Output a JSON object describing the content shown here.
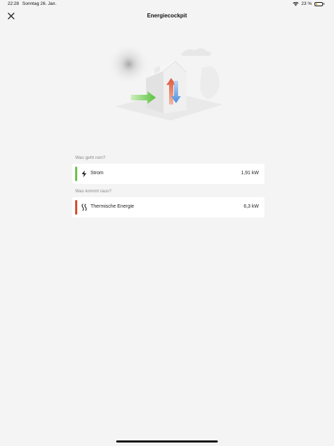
{
  "status": {
    "time": "22:28",
    "date": "Sonntag 26. Jan.",
    "battery": "23 %",
    "battery_level": 0.23
  },
  "header": {
    "title": "Energiecockpit"
  },
  "sections": {
    "input": {
      "label": "Was geht rein?",
      "item": {
        "label": "Strom",
        "value": "1,91 kW",
        "color": "#6cc04a",
        "icon": "lightning-icon"
      }
    },
    "output": {
      "label": "Was kommt raus?",
      "item": {
        "label": "Thermische Energie",
        "value": "6,3 kW",
        "color": "#d9492b",
        "icon": "heat-waves-icon"
      }
    }
  }
}
